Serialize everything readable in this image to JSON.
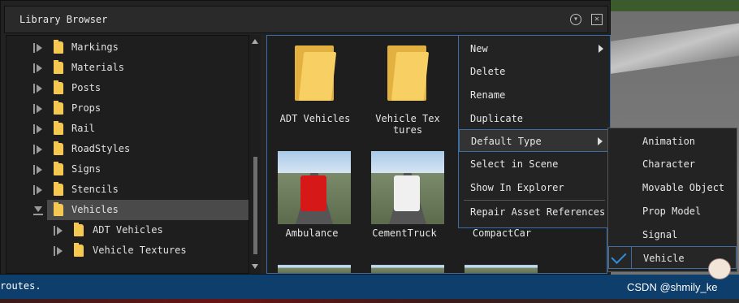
{
  "window": {
    "title": "Library Browser"
  },
  "tree": {
    "items": [
      {
        "label": "Markings",
        "expanded": false
      },
      {
        "label": "Materials",
        "expanded": false
      },
      {
        "label": "Posts",
        "expanded": false
      },
      {
        "label": "Props",
        "expanded": false
      },
      {
        "label": "Rail",
        "expanded": false
      },
      {
        "label": "RoadStyles",
        "expanded": false
      },
      {
        "label": "Signs",
        "expanded": false
      },
      {
        "label": "Stencils",
        "expanded": false
      },
      {
        "label": "Vehicles",
        "expanded": true,
        "selected": true
      },
      {
        "label": "ADT Vehicles",
        "expanded": false
      },
      {
        "label": "Vehicle Textures",
        "expanded": false
      }
    ]
  },
  "assets": {
    "items": [
      {
        "label": "ADT Vehicles",
        "kind": "folder"
      },
      {
        "label": "Vehicle Tex",
        "label2": "tures",
        "kind": "folder"
      },
      {
        "label": "Ambulance",
        "kind": "vehicle",
        "color": "#d71818"
      },
      {
        "label": "CementTruck",
        "kind": "vehicle",
        "color": "#f0f0f0"
      },
      {
        "label": "CompactCar",
        "kind": "vehicle"
      }
    ]
  },
  "context_menu": {
    "items": [
      {
        "label": "New",
        "has_submenu": true
      },
      {
        "label": "Delete"
      },
      {
        "label": "Rename"
      },
      {
        "label": "Duplicate"
      },
      {
        "label": "Default Type",
        "has_submenu": true,
        "hover": true
      },
      {
        "label": "Select in Scene"
      },
      {
        "label": "Show In Explorer"
      },
      {
        "label": "Repair Asset References"
      }
    ]
  },
  "submenu": {
    "items": [
      {
        "label": "Animation"
      },
      {
        "label": "Character"
      },
      {
        "label": "Movable Object"
      },
      {
        "label": "Prop Model"
      },
      {
        "label": "Signal"
      },
      {
        "label": "Vehicle",
        "checked": true
      }
    ]
  },
  "status": {
    "text": "routes.",
    "watermark": "CSDN @shmily_ke"
  },
  "colors": {
    "accent": "#3a6ea5",
    "status_bar": "#0e3e6c",
    "folder": "#f5c851",
    "check": "#2e8ee0"
  }
}
